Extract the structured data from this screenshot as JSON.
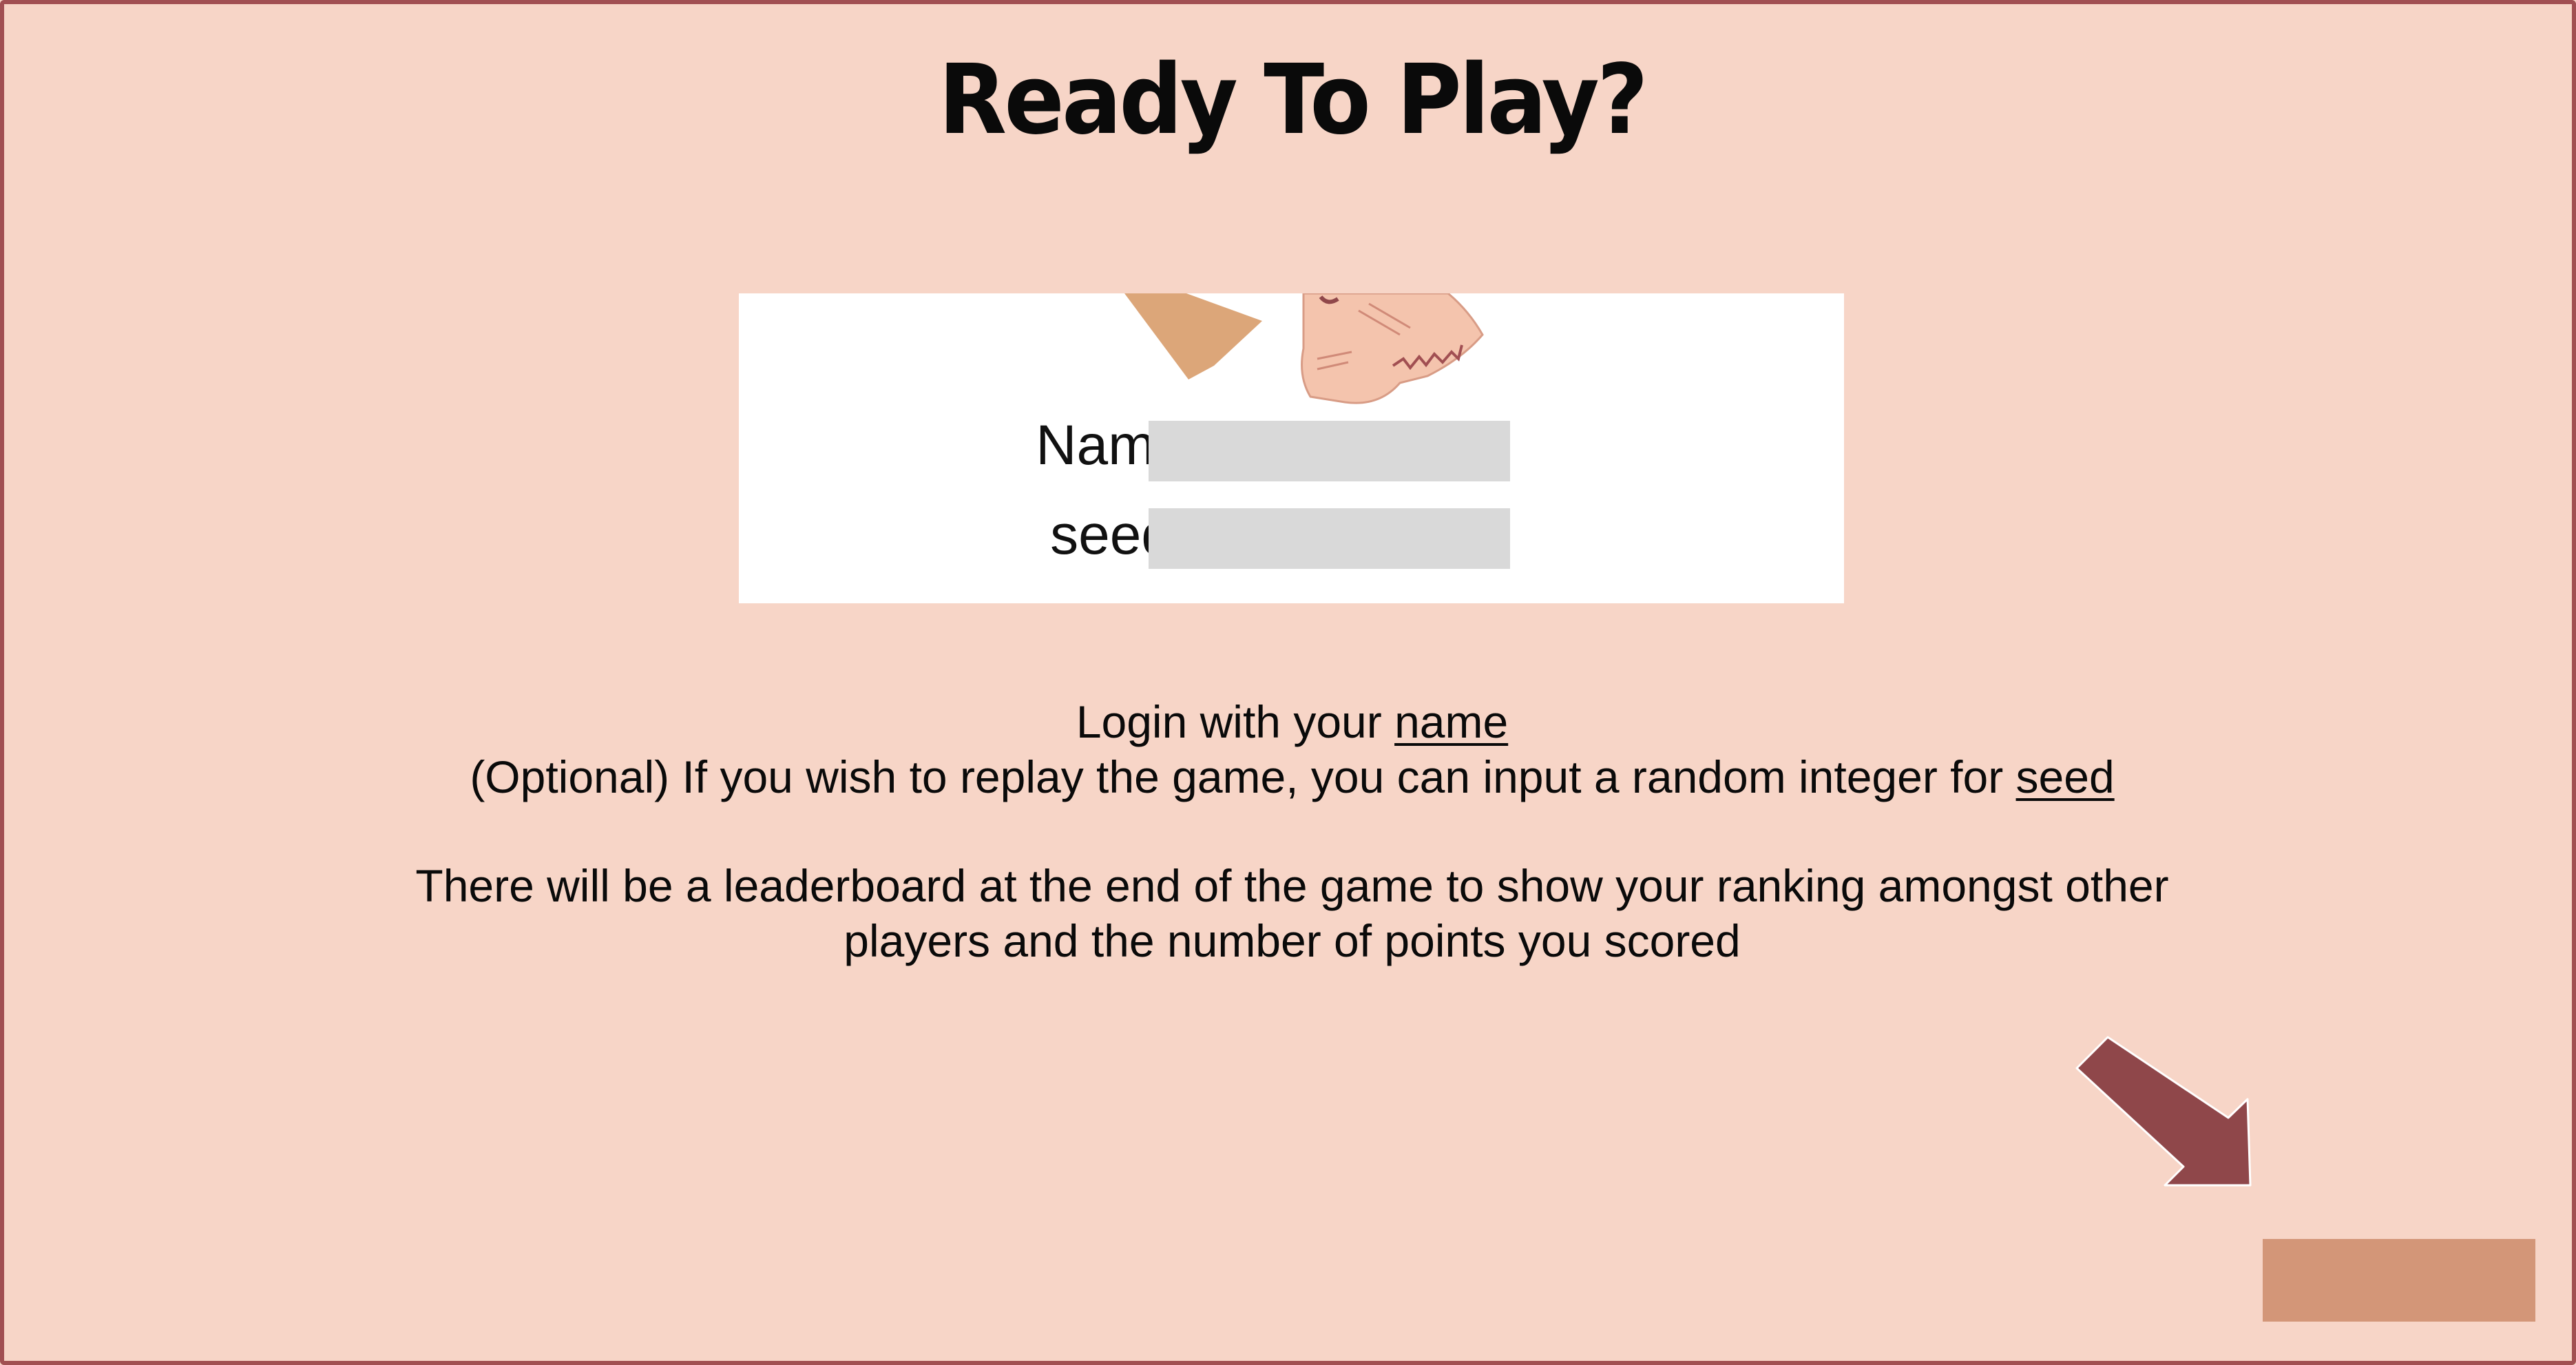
{
  "screen": {
    "title": "Ready To Play?"
  },
  "login_form": {
    "name_label": "Name",
    "name_value": "",
    "seed_label": "seed",
    "seed_value": ""
  },
  "instructions": {
    "line1_prefix": "Login with your ",
    "line1_link": "name",
    "line2_prefix": "(Optional) If you wish to replay the game, you can input a random integer for ",
    "line2_link": "seed",
    "line3": "There will be a leaderboard at the end of the game to show your ranking amongst other",
    "line4": "players and the number of points you scored"
  },
  "next_button": {
    "label": ""
  },
  "colors": {
    "background": "#f7d5c7",
    "border": "#a14f52",
    "arrow": "#8f474a",
    "button": "#d39678",
    "input": "#d9d9d9"
  },
  "icons": {
    "arrow": "arrow-down-right-icon",
    "character": "shark-hand-puppet-illustration"
  }
}
